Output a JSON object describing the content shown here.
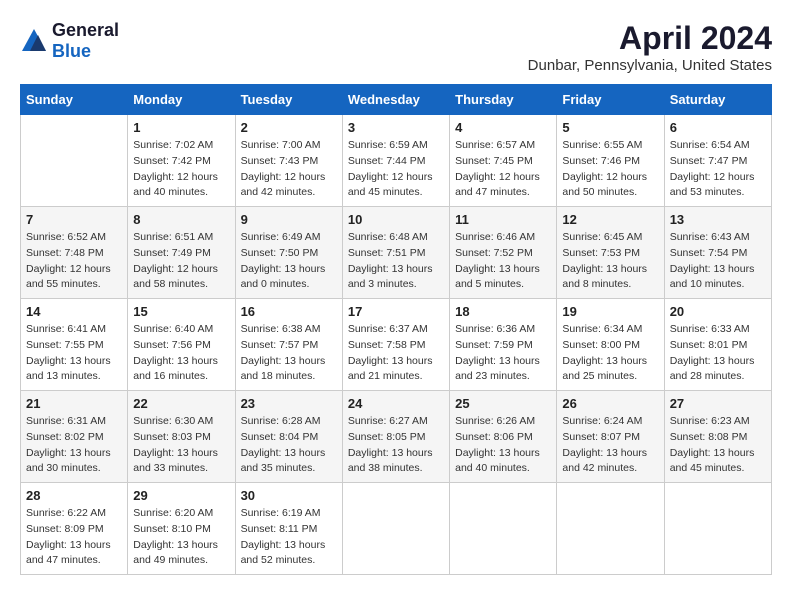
{
  "logo": {
    "general": "General",
    "blue": "Blue"
  },
  "header": {
    "month": "April 2024",
    "location": "Dunbar, Pennsylvania, United States"
  },
  "days_of_week": [
    "Sunday",
    "Monday",
    "Tuesday",
    "Wednesday",
    "Thursday",
    "Friday",
    "Saturday"
  ],
  "weeks": [
    [
      {
        "day": "",
        "sunrise": "",
        "sunset": "",
        "daylight": ""
      },
      {
        "day": "1",
        "sunrise": "Sunrise: 7:02 AM",
        "sunset": "Sunset: 7:42 PM",
        "daylight": "Daylight: 12 hours and 40 minutes."
      },
      {
        "day": "2",
        "sunrise": "Sunrise: 7:00 AM",
        "sunset": "Sunset: 7:43 PM",
        "daylight": "Daylight: 12 hours and 42 minutes."
      },
      {
        "day": "3",
        "sunrise": "Sunrise: 6:59 AM",
        "sunset": "Sunset: 7:44 PM",
        "daylight": "Daylight: 12 hours and 45 minutes."
      },
      {
        "day": "4",
        "sunrise": "Sunrise: 6:57 AM",
        "sunset": "Sunset: 7:45 PM",
        "daylight": "Daylight: 12 hours and 47 minutes."
      },
      {
        "day": "5",
        "sunrise": "Sunrise: 6:55 AM",
        "sunset": "Sunset: 7:46 PM",
        "daylight": "Daylight: 12 hours and 50 minutes."
      },
      {
        "day": "6",
        "sunrise": "Sunrise: 6:54 AM",
        "sunset": "Sunset: 7:47 PM",
        "daylight": "Daylight: 12 hours and 53 minutes."
      }
    ],
    [
      {
        "day": "7",
        "sunrise": "Sunrise: 6:52 AM",
        "sunset": "Sunset: 7:48 PM",
        "daylight": "Daylight: 12 hours and 55 minutes."
      },
      {
        "day": "8",
        "sunrise": "Sunrise: 6:51 AM",
        "sunset": "Sunset: 7:49 PM",
        "daylight": "Daylight: 12 hours and 58 minutes."
      },
      {
        "day": "9",
        "sunrise": "Sunrise: 6:49 AM",
        "sunset": "Sunset: 7:50 PM",
        "daylight": "Daylight: 13 hours and 0 minutes."
      },
      {
        "day": "10",
        "sunrise": "Sunrise: 6:48 AM",
        "sunset": "Sunset: 7:51 PM",
        "daylight": "Daylight: 13 hours and 3 minutes."
      },
      {
        "day": "11",
        "sunrise": "Sunrise: 6:46 AM",
        "sunset": "Sunset: 7:52 PM",
        "daylight": "Daylight: 13 hours and 5 minutes."
      },
      {
        "day": "12",
        "sunrise": "Sunrise: 6:45 AM",
        "sunset": "Sunset: 7:53 PM",
        "daylight": "Daylight: 13 hours and 8 minutes."
      },
      {
        "day": "13",
        "sunrise": "Sunrise: 6:43 AM",
        "sunset": "Sunset: 7:54 PM",
        "daylight": "Daylight: 13 hours and 10 minutes."
      }
    ],
    [
      {
        "day": "14",
        "sunrise": "Sunrise: 6:41 AM",
        "sunset": "Sunset: 7:55 PM",
        "daylight": "Daylight: 13 hours and 13 minutes."
      },
      {
        "day": "15",
        "sunrise": "Sunrise: 6:40 AM",
        "sunset": "Sunset: 7:56 PM",
        "daylight": "Daylight: 13 hours and 16 minutes."
      },
      {
        "day": "16",
        "sunrise": "Sunrise: 6:38 AM",
        "sunset": "Sunset: 7:57 PM",
        "daylight": "Daylight: 13 hours and 18 minutes."
      },
      {
        "day": "17",
        "sunrise": "Sunrise: 6:37 AM",
        "sunset": "Sunset: 7:58 PM",
        "daylight": "Daylight: 13 hours and 21 minutes."
      },
      {
        "day": "18",
        "sunrise": "Sunrise: 6:36 AM",
        "sunset": "Sunset: 7:59 PM",
        "daylight": "Daylight: 13 hours and 23 minutes."
      },
      {
        "day": "19",
        "sunrise": "Sunrise: 6:34 AM",
        "sunset": "Sunset: 8:00 PM",
        "daylight": "Daylight: 13 hours and 25 minutes."
      },
      {
        "day": "20",
        "sunrise": "Sunrise: 6:33 AM",
        "sunset": "Sunset: 8:01 PM",
        "daylight": "Daylight: 13 hours and 28 minutes."
      }
    ],
    [
      {
        "day": "21",
        "sunrise": "Sunrise: 6:31 AM",
        "sunset": "Sunset: 8:02 PM",
        "daylight": "Daylight: 13 hours and 30 minutes."
      },
      {
        "day": "22",
        "sunrise": "Sunrise: 6:30 AM",
        "sunset": "Sunset: 8:03 PM",
        "daylight": "Daylight: 13 hours and 33 minutes."
      },
      {
        "day": "23",
        "sunrise": "Sunrise: 6:28 AM",
        "sunset": "Sunset: 8:04 PM",
        "daylight": "Daylight: 13 hours and 35 minutes."
      },
      {
        "day": "24",
        "sunrise": "Sunrise: 6:27 AM",
        "sunset": "Sunset: 8:05 PM",
        "daylight": "Daylight: 13 hours and 38 minutes."
      },
      {
        "day": "25",
        "sunrise": "Sunrise: 6:26 AM",
        "sunset": "Sunset: 8:06 PM",
        "daylight": "Daylight: 13 hours and 40 minutes."
      },
      {
        "day": "26",
        "sunrise": "Sunrise: 6:24 AM",
        "sunset": "Sunset: 8:07 PM",
        "daylight": "Daylight: 13 hours and 42 minutes."
      },
      {
        "day": "27",
        "sunrise": "Sunrise: 6:23 AM",
        "sunset": "Sunset: 8:08 PM",
        "daylight": "Daylight: 13 hours and 45 minutes."
      }
    ],
    [
      {
        "day": "28",
        "sunrise": "Sunrise: 6:22 AM",
        "sunset": "Sunset: 8:09 PM",
        "daylight": "Daylight: 13 hours and 47 minutes."
      },
      {
        "day": "29",
        "sunrise": "Sunrise: 6:20 AM",
        "sunset": "Sunset: 8:10 PM",
        "daylight": "Daylight: 13 hours and 49 minutes."
      },
      {
        "day": "30",
        "sunrise": "Sunrise: 6:19 AM",
        "sunset": "Sunset: 8:11 PM",
        "daylight": "Daylight: 13 hours and 52 minutes."
      },
      {
        "day": "",
        "sunrise": "",
        "sunset": "",
        "daylight": ""
      },
      {
        "day": "",
        "sunrise": "",
        "sunset": "",
        "daylight": ""
      },
      {
        "day": "",
        "sunrise": "",
        "sunset": "",
        "daylight": ""
      },
      {
        "day": "",
        "sunrise": "",
        "sunset": "",
        "daylight": ""
      }
    ]
  ]
}
